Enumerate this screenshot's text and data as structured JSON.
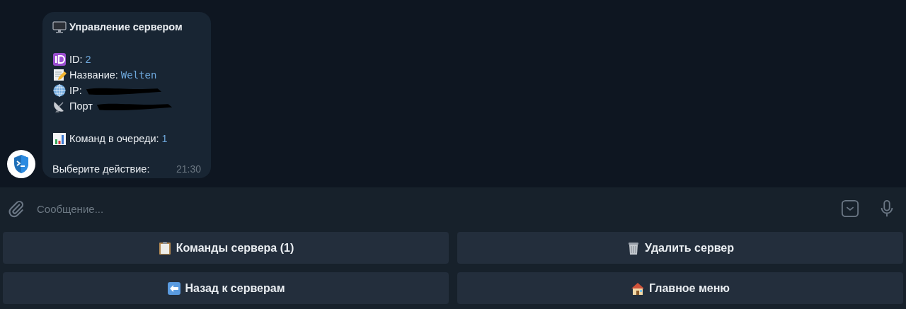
{
  "message": {
    "title": {
      "text": "Управление сервером"
    },
    "fields": [
      {
        "label": "ID:",
        "value": "2",
        "kind": "number",
        "redacted": false
      },
      {
        "label": "Название:",
        "value": "Welten",
        "kind": "code",
        "redacted": false
      },
      {
        "label": "IP:",
        "redacted": true
      },
      {
        "label": "Порт",
        "redacted": true
      }
    ],
    "queue": {
      "label": "Команд в очереди:",
      "value": "1"
    },
    "prompt": "Выберите действие:",
    "time": "21:30"
  },
  "composer": {
    "placeholder": "Сообщение..."
  },
  "keyboard": [
    [
      {
        "label": "Команды сервера (1)"
      },
      {
        "label": "Удалить сервер"
      }
    ],
    [
      {
        "label": "Назад к серверам"
      },
      {
        "label": "Главное меню"
      }
    ]
  ]
}
